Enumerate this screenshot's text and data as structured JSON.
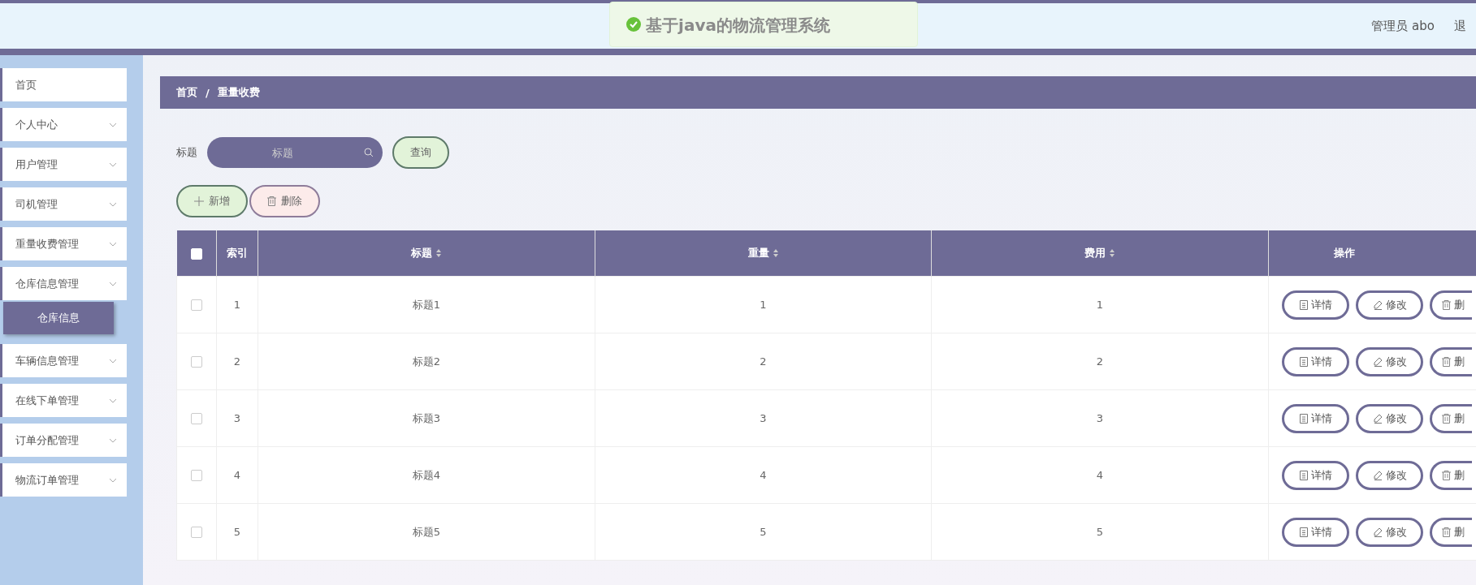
{
  "header": {
    "title": "基于java的物流管理系统",
    "user": "管理员 abo",
    "logout": "退"
  },
  "toast": {
    "kind": "success"
  },
  "sidebar": {
    "items": [
      {
        "label": "首页",
        "expandable": false
      },
      {
        "label": "个人中心",
        "expandable": true
      },
      {
        "label": "用户管理",
        "expandable": true
      },
      {
        "label": "司机管理",
        "expandable": true
      },
      {
        "label": "重量收费管理",
        "expandable": true
      },
      {
        "label": "仓库信息管理",
        "expandable": true,
        "submenu": "仓库信息"
      },
      {
        "label": "车辆信息管理",
        "expandable": true
      },
      {
        "label": "在线下单管理",
        "expandable": true
      },
      {
        "label": "订单分配管理",
        "expandable": true
      },
      {
        "label": "物流订单管理",
        "expandable": true
      }
    ]
  },
  "breadcrumb": [
    "首页",
    "/",
    "重量收费"
  ],
  "search": {
    "label": "标题",
    "placeholder": "标题",
    "button": "查询"
  },
  "actions": [
    {
      "kind": "add",
      "label": "新增"
    },
    {
      "kind": "delete",
      "label": "删除"
    }
  ],
  "table": {
    "select_all": {
      "checked": false
    },
    "columns": [
      {
        "label": "索引",
        "sortable": false
      },
      {
        "label": "标题",
        "sortable": true
      },
      {
        "label": "重量",
        "sortable": true
      },
      {
        "label": "费用",
        "sortable": true
      },
      {
        "label": "操作",
        "sortable": false
      }
    ],
    "rows": [
      {
        "checked": false,
        "cells": [
          "1",
          "标题1",
          "1",
          "1"
        ],
        "actions": [
          {
            "kind": "detail",
            "label": "详情"
          },
          {
            "kind": "edit",
            "label": "修改"
          },
          {
            "kind": "delete",
            "label": "删"
          }
        ]
      },
      {
        "checked": false,
        "cells": [
          "2",
          "标题2",
          "2",
          "2"
        ],
        "actions": [
          {
            "kind": "detail",
            "label": "详情"
          },
          {
            "kind": "edit",
            "label": "修改"
          },
          {
            "kind": "delete",
            "label": "删"
          }
        ]
      },
      {
        "checked": false,
        "cells": [
          "3",
          "标题3",
          "3",
          "3"
        ],
        "actions": [
          {
            "kind": "detail",
            "label": "详情"
          },
          {
            "kind": "edit",
            "label": "修改"
          },
          {
            "kind": "delete",
            "label": "删"
          }
        ]
      },
      {
        "checked": false,
        "cells": [
          "4",
          "标题4",
          "4",
          "4"
        ],
        "actions": [
          {
            "kind": "detail",
            "label": "详情"
          },
          {
            "kind": "edit",
            "label": "修改"
          },
          {
            "kind": "delete",
            "label": "删"
          }
        ]
      },
      {
        "checked": false,
        "cells": [
          "5",
          "标题5",
          "5",
          "5"
        ],
        "actions": [
          {
            "kind": "detail",
            "label": "详情"
          },
          {
            "kind": "edit",
            "label": "修改"
          },
          {
            "kind": "delete",
            "label": "删"
          }
        ]
      }
    ]
  }
}
